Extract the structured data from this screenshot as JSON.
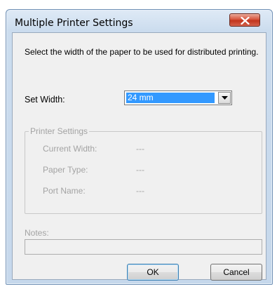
{
  "window": {
    "title": "Multiple Printer Settings"
  },
  "description": "Select the width of the paper to be used for distributed printing.",
  "set_width": {
    "label": "Set Width:",
    "selected": "24 mm"
  },
  "printer_settings": {
    "legend": "Printer Settings",
    "rows": [
      {
        "label": "Current Width:",
        "value": "---"
      },
      {
        "label": "Paper Type:",
        "value": "---"
      },
      {
        "label": "Port Name:",
        "value": "---"
      }
    ]
  },
  "notes": {
    "label": "Notes:",
    "value": ""
  },
  "buttons": {
    "ok": "OK",
    "cancel": "Cancel"
  },
  "icons": {
    "close": "close-icon",
    "dropdown": "chevron-down-icon"
  },
  "colors": {
    "selection": "#3399ff",
    "disabled_text": "#a3a3a3",
    "close_button": "#c2341c"
  }
}
